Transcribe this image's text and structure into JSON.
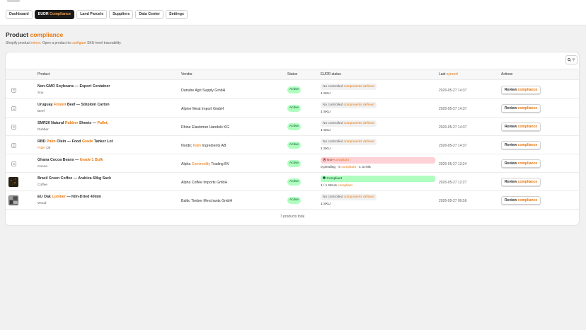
{
  "nav": {
    "tabs": [
      {
        "label": "Dashboard"
      },
      {
        "label_a": "EUDR ",
        "label_b": "Compliance"
      },
      {
        "label": "Land Parcels"
      },
      {
        "label": "Suppliers"
      },
      {
        "label": "Data Center"
      },
      {
        "label": "Settings"
      }
    ]
  },
  "page": {
    "title_a": "Product ",
    "title_b": "compliance",
    "sub_a": "Shopify product ",
    "sub_b": "mirror",
    "sub_c": ". Open a product to ",
    "sub_d": "configure",
    "sub_e": " SKU-level traceability."
  },
  "table": {
    "headers": {
      "product": "Product",
      "vendor": "Vendor",
      "status": "Status",
      "eudr": "EUDR status",
      "synced_a": "Last ",
      "synced_b": "synced",
      "actions": "Actions"
    },
    "rows": [
      {
        "name_a": "Non-GMO Soybeans — Export Container",
        "category": "Soy",
        "vendor_a": "Danube Agri Supply GmbH",
        "status": "Active",
        "pill_a": "No controlled ",
        "pill_b": "components defined",
        "sub_a": "1 SKU",
        "synced": "2026-05-27 14:37",
        "review_a": "Review ",
        "review_b": "compliance"
      },
      {
        "name_a": "Uruguay ",
        "name_b": "Frozen",
        "name_c": " Beef — Striploin Carton",
        "category": "Beef",
        "vendor_a": "Alpine Meat Import GmbH",
        "status": "Active",
        "pill_a": "No controlled ",
        "pill_b": "components defined",
        "sub_a": "1 SKU",
        "synced": "2026-05-27 14:37",
        "review_a": "Review ",
        "review_b": "compliance"
      },
      {
        "name_a": "SMR20 Natural ",
        "name_b": "Rubber",
        "name_c": " Sheets — ",
        "name_d": "Pallet,",
        "category_hl": "Rubber",
        "vendor_a": "Rhine Elastomer Handels KG",
        "status": "Active",
        "pill_a": "No controlled ",
        "pill_b": "components defined",
        "sub_a": "1 SKU",
        "synced": "2026-05-27 14:37",
        "review_a": "Review ",
        "review_b": "compliance"
      },
      {
        "name_a": "RBD ",
        "name_b": "Palm",
        "name_c": " Olein — Food ",
        "name_d": "Grade",
        "name_e": " Tanker Lot",
        "category_a": "Palm",
        "category_b": " Oil",
        "vendor_a": "Nordic ",
        "vendor_b": "Palm",
        "vendor_c": " Ingredients AB",
        "status": "Active",
        "pill_a": "No controlled ",
        "pill_b": "components defined",
        "sub_a": "1 SKU",
        "synced": "2026-05-27 14:37",
        "review_a": "Review ",
        "review_b": "compliance"
      },
      {
        "name_a": "Ghana Cocoa Beans — ",
        "name_b": "Grade 1 Bulk",
        "category": "Cocoa",
        "vendor_a": "Alpha ",
        "vendor_b": "Commodity",
        "vendor_c": " Trading BV",
        "status": "Active",
        "pill_a": "Non-",
        "pill_b": "compliant",
        "sub_a": "0 pending · 0 ",
        "sub_b": "compliant",
        "sub_c": " · 1 at risk",
        "synced": "2026-05-27 13:24",
        "review_a": "Review ",
        "review_b": "compliance"
      },
      {
        "name_a": "Brazil Green Coffee — Arabica 60kg Sack",
        "category": "Coffee",
        "vendor_a": "Alpha Coffee Imports GmbH",
        "status": "Active",
        "pill_a": "Compliant",
        "sub_a": "1 / 1 SKUs ",
        "sub_b": "compliant",
        "synced": "2026-05-27 12:27",
        "review_a": "Review ",
        "review_b": "compliance"
      },
      {
        "name_a": "EU Oak ",
        "name_b": "Lumber",
        "name_c": " — Kiln-Dried 40mm",
        "category": "Wood",
        "vendor_a": "Baltic Timber Merchants GmbH",
        "status": "Active",
        "pill_a": "No controlled ",
        "pill_b": "components defined",
        "sub_a": "1 SKU",
        "synced": "2026-05-27 09:56",
        "review_a": "Review ",
        "review_b": "compliance"
      }
    ],
    "footer": "7 products total"
  },
  "colors": {
    "accent": "#e8760a",
    "active_badge": "#affebf",
    "noncompliant": "#fed1d7",
    "compliant": "#affebf"
  },
  "icons": {
    "filter": "search-filter-icon",
    "product_placeholder": "image-placeholder-icon",
    "noncompliant": "x-circle-icon",
    "compliant": "check-dot-icon"
  }
}
